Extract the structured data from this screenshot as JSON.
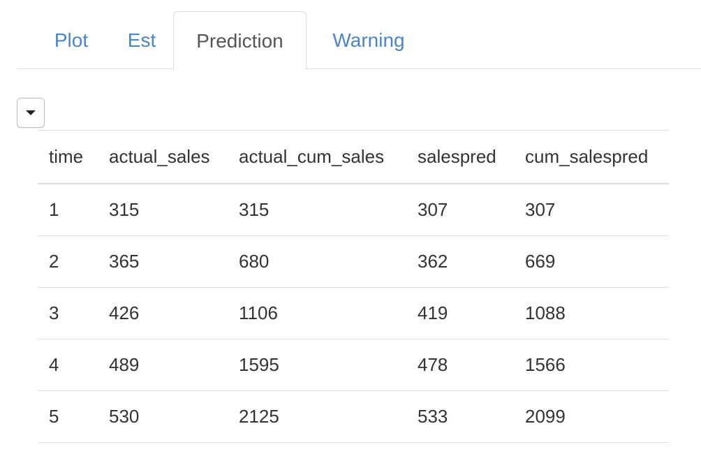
{
  "tabs": [
    {
      "label": "Plot",
      "active": false
    },
    {
      "label": "Est",
      "active": false
    },
    {
      "label": "Prediction",
      "active": true
    },
    {
      "label": "Warning",
      "active": false
    }
  ],
  "dropdown": {
    "icon": "caret-down-icon"
  },
  "table": {
    "headers": [
      "time",
      "actual_sales",
      "actual_cum_sales",
      "salespred",
      "cum_salespred"
    ],
    "rows": [
      [
        "1",
        "315",
        "315",
        "307",
        "307"
      ],
      [
        "2",
        "365",
        "680",
        "362",
        "669"
      ],
      [
        "3",
        "426",
        "1106",
        "419",
        "1088"
      ],
      [
        "4",
        "489",
        "1595",
        "478",
        "1566"
      ],
      [
        "5",
        "530",
        "2125",
        "533",
        "2099"
      ]
    ]
  },
  "colors": {
    "link": "#4a86c5",
    "active_tab_text": "#555555",
    "border": "#dddddd",
    "text": "#333333"
  }
}
